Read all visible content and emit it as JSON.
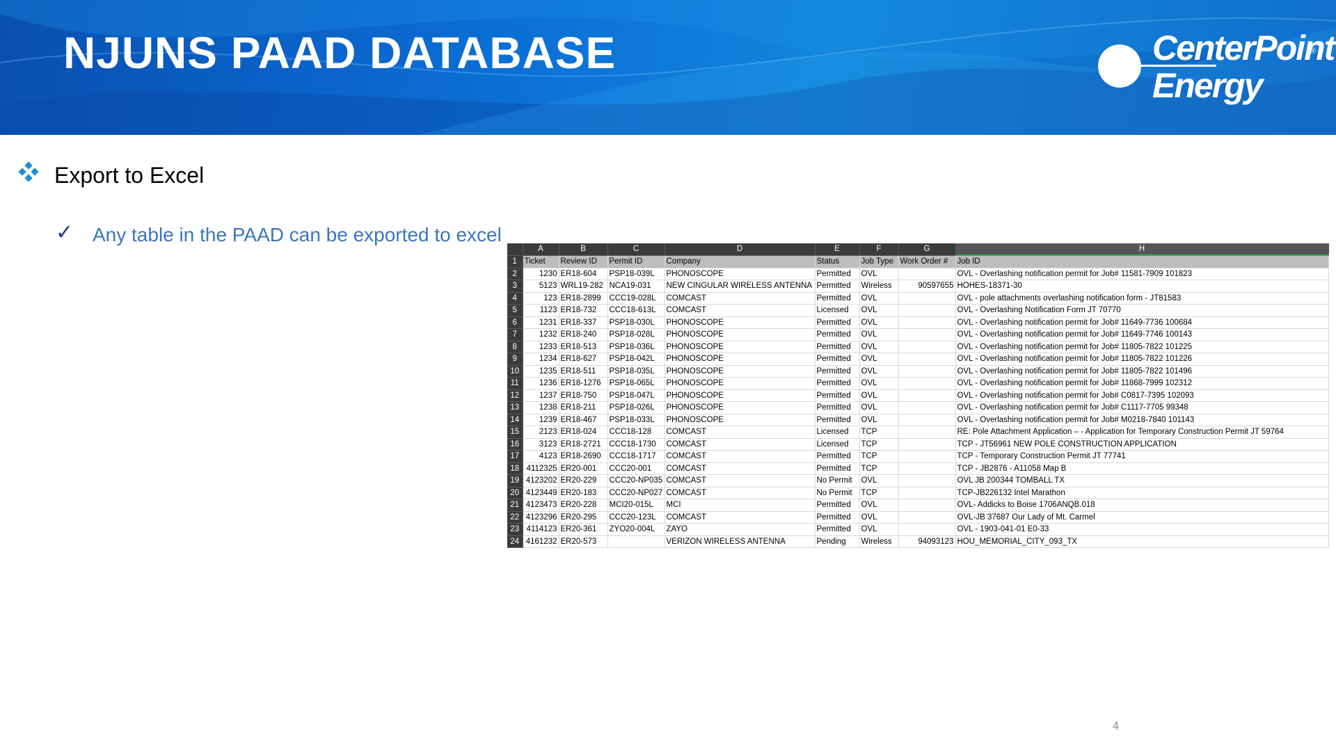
{
  "slide": {
    "title": "NJUNS PAAD DATABASE",
    "logo": {
      "line1": "CenterPoint",
      "line2": "Energy",
      "reg": "®"
    },
    "bullet1": "Export to Excel",
    "bullet2": "Any table in the PAAD can be exported to excel",
    "page_number": "4",
    "colors": {
      "header_blue": "#0b6fd6",
      "bullet_blue": "#3a75bd",
      "diamond": "#1a8fd6"
    }
  },
  "sheet": {
    "columns": [
      "A",
      "B",
      "C",
      "D",
      "E",
      "F",
      "G",
      "H"
    ],
    "header_row": [
      "Ticket",
      "Review ID",
      "Permit ID",
      "Company",
      "Status",
      "Job Type",
      "Work Order #",
      "Job ID"
    ],
    "rows": [
      [
        "1230",
        "ER18-604",
        "PSP18-039L",
        "PHONOSCOPE",
        "Permitted",
        "OVL",
        "",
        "OVL - Overlashing notification permit for Job# 11581-7909 101823"
      ],
      [
        "5123",
        "WRL19-282",
        "NCA19-031",
        "NEW CINGULAR WIRELESS ANTENNA",
        "Permitted",
        "Wireless",
        "90597655",
        "HOHES-18371-30"
      ],
      [
        "123",
        "ER18-2899",
        "CCC19-028L",
        "COMCAST",
        "Permitted",
        "OVL",
        "",
        "OVL -  pole attachments overlashing notification form - JT81583"
      ],
      [
        "1123",
        "ER18-732",
        "CCC18-613L",
        "COMCAST",
        "Licensed",
        "OVL",
        "",
        "OVL - Overlashing Notification Form JT 70770"
      ],
      [
        "1231",
        "ER18-337",
        "PSP18-030L",
        "PHONOSCOPE",
        "Permitted",
        "OVL",
        "",
        "OVL - Overlashing notification permit for Job# 11649-7736 100684"
      ],
      [
        "1232",
        "ER18-240",
        "PSP18-028L",
        "PHONOSCOPE",
        "Permitted",
        "OVL",
        "",
        "OVL - Overlashing notification permit for Job# 11649-7746 100143"
      ],
      [
        "1233",
        "ER18-513",
        "PSP18-036L",
        "PHONOSCOPE",
        "Permitted",
        "OVL",
        "",
        "OVL - Overlashing notification permit for Job# 11805-7822 101225"
      ],
      [
        "1234",
        "ER18-627",
        "PSP18-042L",
        "PHONOSCOPE",
        "Permitted",
        "OVL",
        "",
        "OVL - Overlashing notification permit for Job# 11805-7822 101226"
      ],
      [
        "1235",
        "ER18-511",
        "PSP18-035L",
        "PHONOSCOPE",
        "Permitted",
        "OVL",
        "",
        "OVL - Overlashing notification permit for Job# 11805-7822 101496"
      ],
      [
        "1236",
        "ER18-1276",
        "PSP18-065L",
        "PHONOSCOPE",
        "Permitted",
        "OVL",
        "",
        "OVL - Overlashing notification permit for Job# 11868-7999 102312"
      ],
      [
        "1237",
        "ER18-750",
        "PSP18-047L",
        "PHONOSCOPE",
        "Permitted",
        "OVL",
        "",
        "OVL - Overlashing notification permit for Job# C0817-7395 102093"
      ],
      [
        "1238",
        "ER18-211",
        "PSP18-026L",
        "PHONOSCOPE",
        "Permitted",
        "OVL",
        "",
        "OVL - Overlashing notification permit for Job# C1117-7705 99348"
      ],
      [
        "1239",
        "ER18-467",
        "PSP18-033L",
        "PHONOSCOPE",
        "Permitted",
        "OVL",
        "",
        "OVL - Overlashing notification permit for Job# M0218-7840 101143"
      ],
      [
        "2123",
        "ER18-024",
        "CCC18-128",
        "COMCAST",
        "Licensed",
        "TCP",
        "",
        "RE: Pole Attachment Application – - Application for  Temporary Construction Permit JT 59764"
      ],
      [
        "3123",
        "ER18-2721",
        "CCC18-1730",
        "COMCAST",
        "Licensed",
        "TCP",
        "",
        "TCP - JT56961 NEW POLE CONSTRUCTION APPLICATION"
      ],
      [
        "4123",
        "ER18-2690",
        "CCC18-1717",
        "COMCAST",
        "Permitted",
        "TCP",
        "",
        "TCP - Temporary Construction Permit JT 77741"
      ],
      [
        "4112325",
        "ER20-001",
        "CCC20-001",
        "COMCAST",
        "Permitted",
        "TCP",
        "",
        "TCP - JB2876 - A11058 Map B"
      ],
      [
        "4123202",
        "ER20-229",
        "CCC20-NP035",
        "COMCAST",
        "No Permit",
        "OVL",
        "",
        "OVL JB 200344 TOMBALL TX"
      ],
      [
        "4123449",
        "ER20-183",
        "CCC20-NP027",
        "COMCAST",
        "No Permit",
        "TCP",
        "",
        "TCP-JB226132 Intel Marathon"
      ],
      [
        "4123473",
        "ER20-228",
        "MCI20-015L",
        "MCI",
        "Permitted",
        "OVL",
        "",
        "OVL- Addicks to Boise 1706ANQB.018"
      ],
      [
        "4123296",
        "ER20-295",
        "CCC20-123L",
        "COMCAST",
        "Permitted",
        "OVL",
        "",
        "OVL-JB 37687 Our Lady of Mt. Carmel"
      ],
      [
        "4114123",
        "ER20-361",
        "ZYO20-004L",
        "ZAYO",
        "Permitted",
        "OVL",
        "",
        "OVL - 1903-041-01 E0-33"
      ],
      [
        "4161232",
        "ER20-573",
        "",
        "VERIZON WIRELESS ANTENNA",
        "Pending",
        "Wireless",
        "94093123",
        "HOU_MEMORIAL_CITY_093_TX"
      ]
    ]
  }
}
